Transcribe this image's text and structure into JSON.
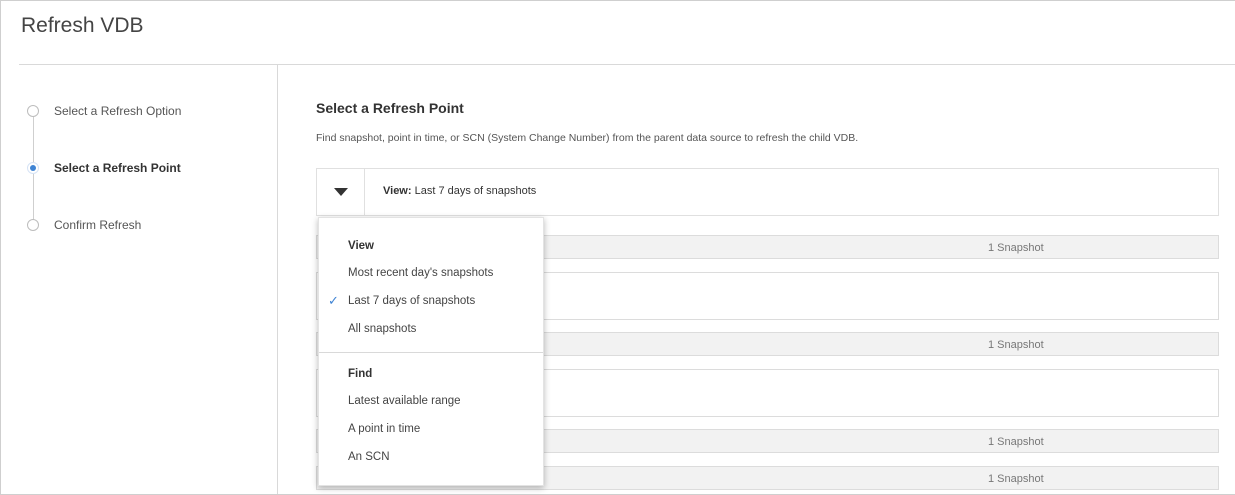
{
  "dialog": {
    "title": "Refresh VDB"
  },
  "steps": [
    {
      "label": "Select a Refresh Option",
      "active": false
    },
    {
      "label": "Select a Refresh Point",
      "active": true
    },
    {
      "label": "Confirm Refresh",
      "active": false
    }
  ],
  "main": {
    "heading": "Select a Refresh Point",
    "description": "Find snapshot, point in time, or SCN (System Change Number) from the parent data source to refresh the child VDB.",
    "view_bar": {
      "label": "View:",
      "value": "Last 7 days of snapshots"
    },
    "rows": [
      {
        "type": "bar",
        "count": "1 Snapshot"
      },
      {
        "type": "box"
      },
      {
        "type": "bar",
        "count": "1 Snapshot"
      },
      {
        "type": "box"
      },
      {
        "type": "bar",
        "count": "1 Snapshot"
      },
      {
        "type": "bar",
        "count": "1 Snapshot"
      }
    ]
  },
  "dropdown": {
    "view_header": "View",
    "view_options": [
      "Most recent day's snapshots",
      "Last 7 days of snapshots",
      "All snapshots"
    ],
    "selected_option": "Last 7 days of snapshots",
    "find_header": "Find",
    "find_options": [
      "Latest available range",
      "A point in time",
      "An SCN"
    ]
  },
  "colors": {
    "accent": "#3f84d4"
  }
}
